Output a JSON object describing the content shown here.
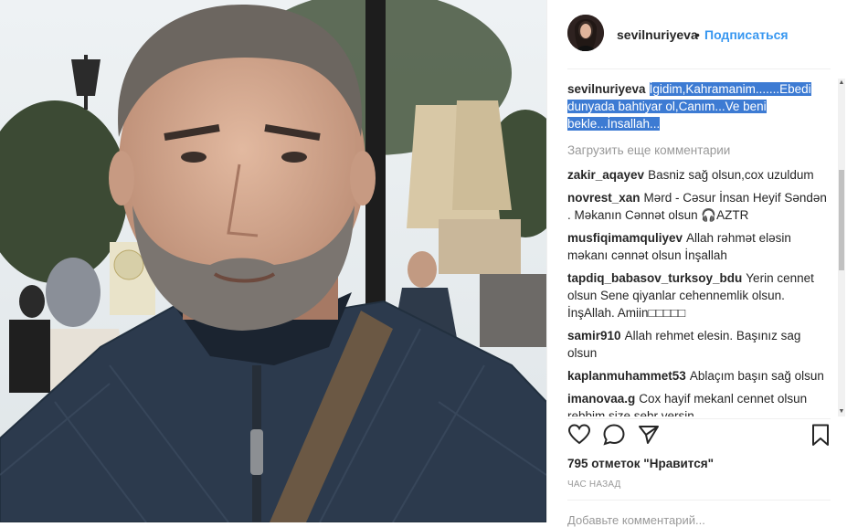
{
  "header": {
    "username": "sevilnuriyeva",
    "separator": "•",
    "follow_label": "Подписаться"
  },
  "caption": {
    "username": "sevilnuriyeva",
    "text": "İgidim,Kahramanim.......Ebedi dunyada bahtiyar ol,Canım...Ve beni bekle...İnsallah..."
  },
  "load_more_label": "Загрузить еще комментарии",
  "comments": [
    {
      "username": "zakir_aqayev",
      "text": "Basniz sağ olsun,cox uzuldum"
    },
    {
      "username": "novrest_xan",
      "text": "Mərd - Cəsur İnsan Heyif Səndən . Məkanın Cənnət olsun 🎧AZTR"
    },
    {
      "username": "musfiqimamquliyev",
      "text": "Allah rəhmət eləsin məkanı cənnət olsun İnşallah"
    },
    {
      "username": "tapdiq_babasov_turksoy_bdu",
      "text": "Yerin cennet olsun Sene qiyanlar cehennemlik olsun. İnşAllah. Amiin□□□□□"
    },
    {
      "username": "samir910",
      "text": "Allah rehmet elesin. Başınız sag olsun"
    },
    {
      "username": "kaplanmuhammet53",
      "text": "Ablaçım başın sağ olsun"
    },
    {
      "username": "imanovaa.g",
      "text": "Cox hayif mekanl cennet olsun rebbim size sebr versin"
    }
  ],
  "likes_text": "795 отметок \"Нравится\"",
  "time_text": "ЧАС НАЗАД",
  "add_comment_placeholder": "Добавьте комментарий...",
  "icons": [
    "heart-icon",
    "comment-icon",
    "share-icon",
    "bookmark-icon"
  ],
  "colors": {
    "accent": "#3897f0",
    "highlight": "#3d7bd3",
    "muted": "#999999"
  }
}
